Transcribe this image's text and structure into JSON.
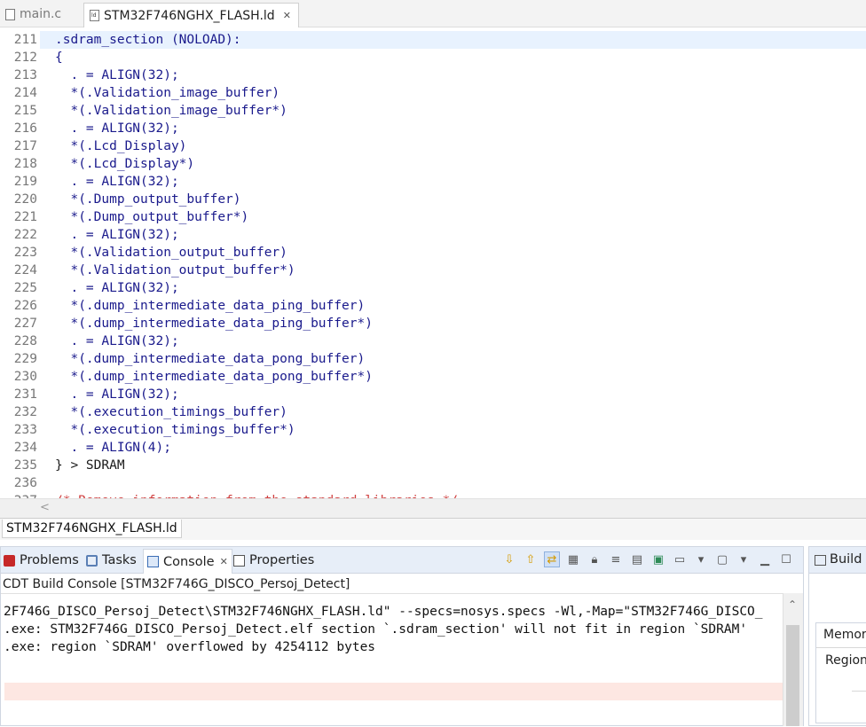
{
  "editor_tabs": [
    {
      "label": "main.c",
      "active": false
    },
    {
      "label": "STM32F746NGHX_FLASH.ld",
      "active": true
    }
  ],
  "code_lines": [
    {
      "num": "211",
      "text": ".sdram_section (NOLOAD):",
      "current": true
    },
    {
      "num": "212",
      "text": "{"
    },
    {
      "num": "213",
      "text": "  . = ALIGN(32);"
    },
    {
      "num": "214",
      "text": "  *(.Validation_image_buffer)"
    },
    {
      "num": "215",
      "text": "  *(.Validation_image_buffer*)"
    },
    {
      "num": "216",
      "text": "  . = ALIGN(32);"
    },
    {
      "num": "217",
      "text": "  *(.Lcd_Display)"
    },
    {
      "num": "218",
      "text": "  *(.Lcd_Display*)"
    },
    {
      "num": "219",
      "text": "  . = ALIGN(32);"
    },
    {
      "num": "220",
      "text": "  *(.Dump_output_buffer)"
    },
    {
      "num": "221",
      "text": "  *(.Dump_output_buffer*)"
    },
    {
      "num": "222",
      "text": "  . = ALIGN(32);"
    },
    {
      "num": "223",
      "text": "  *(.Validation_output_buffer)"
    },
    {
      "num": "224",
      "text": "  *(.Validation_output_buffer*)"
    },
    {
      "num": "225",
      "text": "  . = ALIGN(32);"
    },
    {
      "num": "226",
      "text": "  *(.dump_intermediate_data_ping_buffer)"
    },
    {
      "num": "227",
      "text": "  *(.dump_intermediate_data_ping_buffer*)"
    },
    {
      "num": "228",
      "text": "  . = ALIGN(32);"
    },
    {
      "num": "229",
      "text": "  *(.dump_intermediate_data_pong_buffer)"
    },
    {
      "num": "230",
      "text": "  *(.dump_intermediate_data_pong_buffer*)"
    },
    {
      "num": "231",
      "text": "  . = ALIGN(32);"
    },
    {
      "num": "232",
      "text": "  *(.execution_timings_buffer)"
    },
    {
      "num": "233",
      "text": "  *(.execution_timings_buffer*)"
    },
    {
      "num": "234",
      "text": "  . = ALIGN(4);"
    },
    {
      "num": "235",
      "text": "} > SDRAM",
      "plain": true
    },
    {
      "num": "236",
      "text": ""
    },
    {
      "num": "237",
      "text": "/* Remove information from the standard libraries */",
      "comment": true
    }
  ],
  "source_tab": {
    "label": "STM32F746NGHX_FLASH.ld"
  },
  "view_tabs": {
    "problems": "Problems",
    "tasks": "Tasks",
    "console": "Console",
    "properties": "Properties"
  },
  "console": {
    "title": "CDT Build Console [STM32F746G_DISCO_Persoj_Detect]",
    "lines": [
      "2F746G_DISCO_Persoj_Detect\\STM32F746NGHX_FLASH.ld\" --specs=nosys.specs -Wl,-Map=\"STM32F746G_DISCO_",
      ".exe: STM32F746G_DISCO_Persoj_Detect.elf section `.sdram_section' will not fit in region `SDRAM'",
      ".exe: region `SDRAM' overflowed by 4254112 bytes"
    ]
  },
  "build_view": {
    "tab_label": "Build Analyzer",
    "panel_tab1": "Memory Regions",
    "panel_tab2": "Region"
  },
  "colors": {
    "keyword_blue": "#1a1a8c",
    "comment_red": "#d04040",
    "current_line": "#e8f2fe",
    "error_highlight": "#fde7e2"
  }
}
